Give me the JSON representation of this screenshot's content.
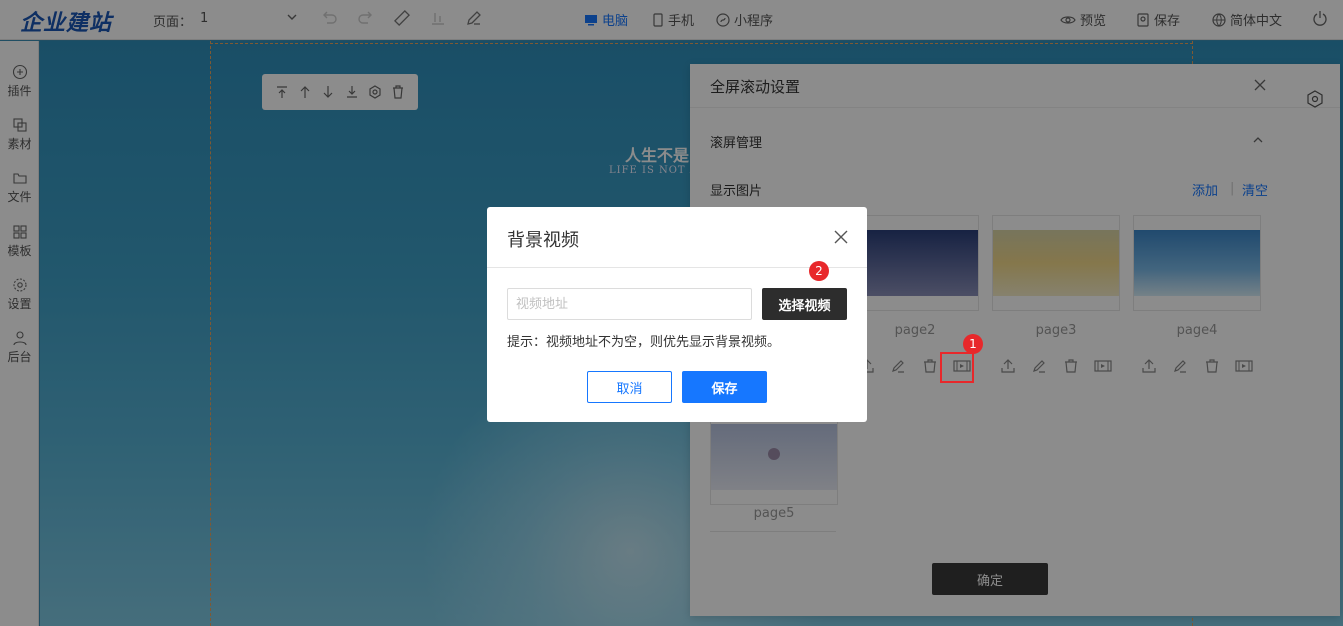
{
  "header": {
    "logo": "企业建站",
    "page_label": "页面：",
    "page_value": "1",
    "device_tabs": [
      {
        "label": "电脑",
        "active": true
      },
      {
        "label": "手机",
        "active": false
      },
      {
        "label": "小程序",
        "active": false
      }
    ],
    "preview_label": "预览",
    "save_label": "保存",
    "language_label": "简体中文"
  },
  "sidebar": {
    "items": [
      {
        "label": "插件",
        "icon": "plus-circle-icon"
      },
      {
        "label": "素材",
        "icon": "material-icon"
      },
      {
        "label": "文件",
        "icon": "folder-icon"
      },
      {
        "label": "模板",
        "icon": "grid-icon"
      },
      {
        "label": "设置",
        "icon": "gear-icon"
      },
      {
        "label": "后台",
        "icon": "user-icon"
      }
    ]
  },
  "canvas": {
    "hero_title": "人生不是",
    "hero_subtitle": "LIFE IS NOT A"
  },
  "panel": {
    "title": "全屏滚动设置",
    "section_title": "滚屏管理",
    "images_label": "显示图片",
    "add_link": "添加",
    "separator": "|",
    "clear_link": "清空",
    "pages": [
      {
        "label": "page2"
      },
      {
        "label": "page3"
      },
      {
        "label": "page4"
      },
      {
        "label": "page5"
      }
    ],
    "confirm_label": "确定"
  },
  "dialog": {
    "title": "背景视频",
    "input_placeholder": "视频地址",
    "input_value": "",
    "select_button": "选择视频",
    "tip": "提示：视频地址不为空，则优先显示背景视频。",
    "cancel_label": "取消",
    "save_label": "保存"
  },
  "annotations": {
    "badge1": "1",
    "badge2": "2"
  },
  "colors": {
    "accent": "#1677ff",
    "brand": "#1a56b5",
    "badge": "#e8282b",
    "dark_button": "#2d2d2d"
  }
}
